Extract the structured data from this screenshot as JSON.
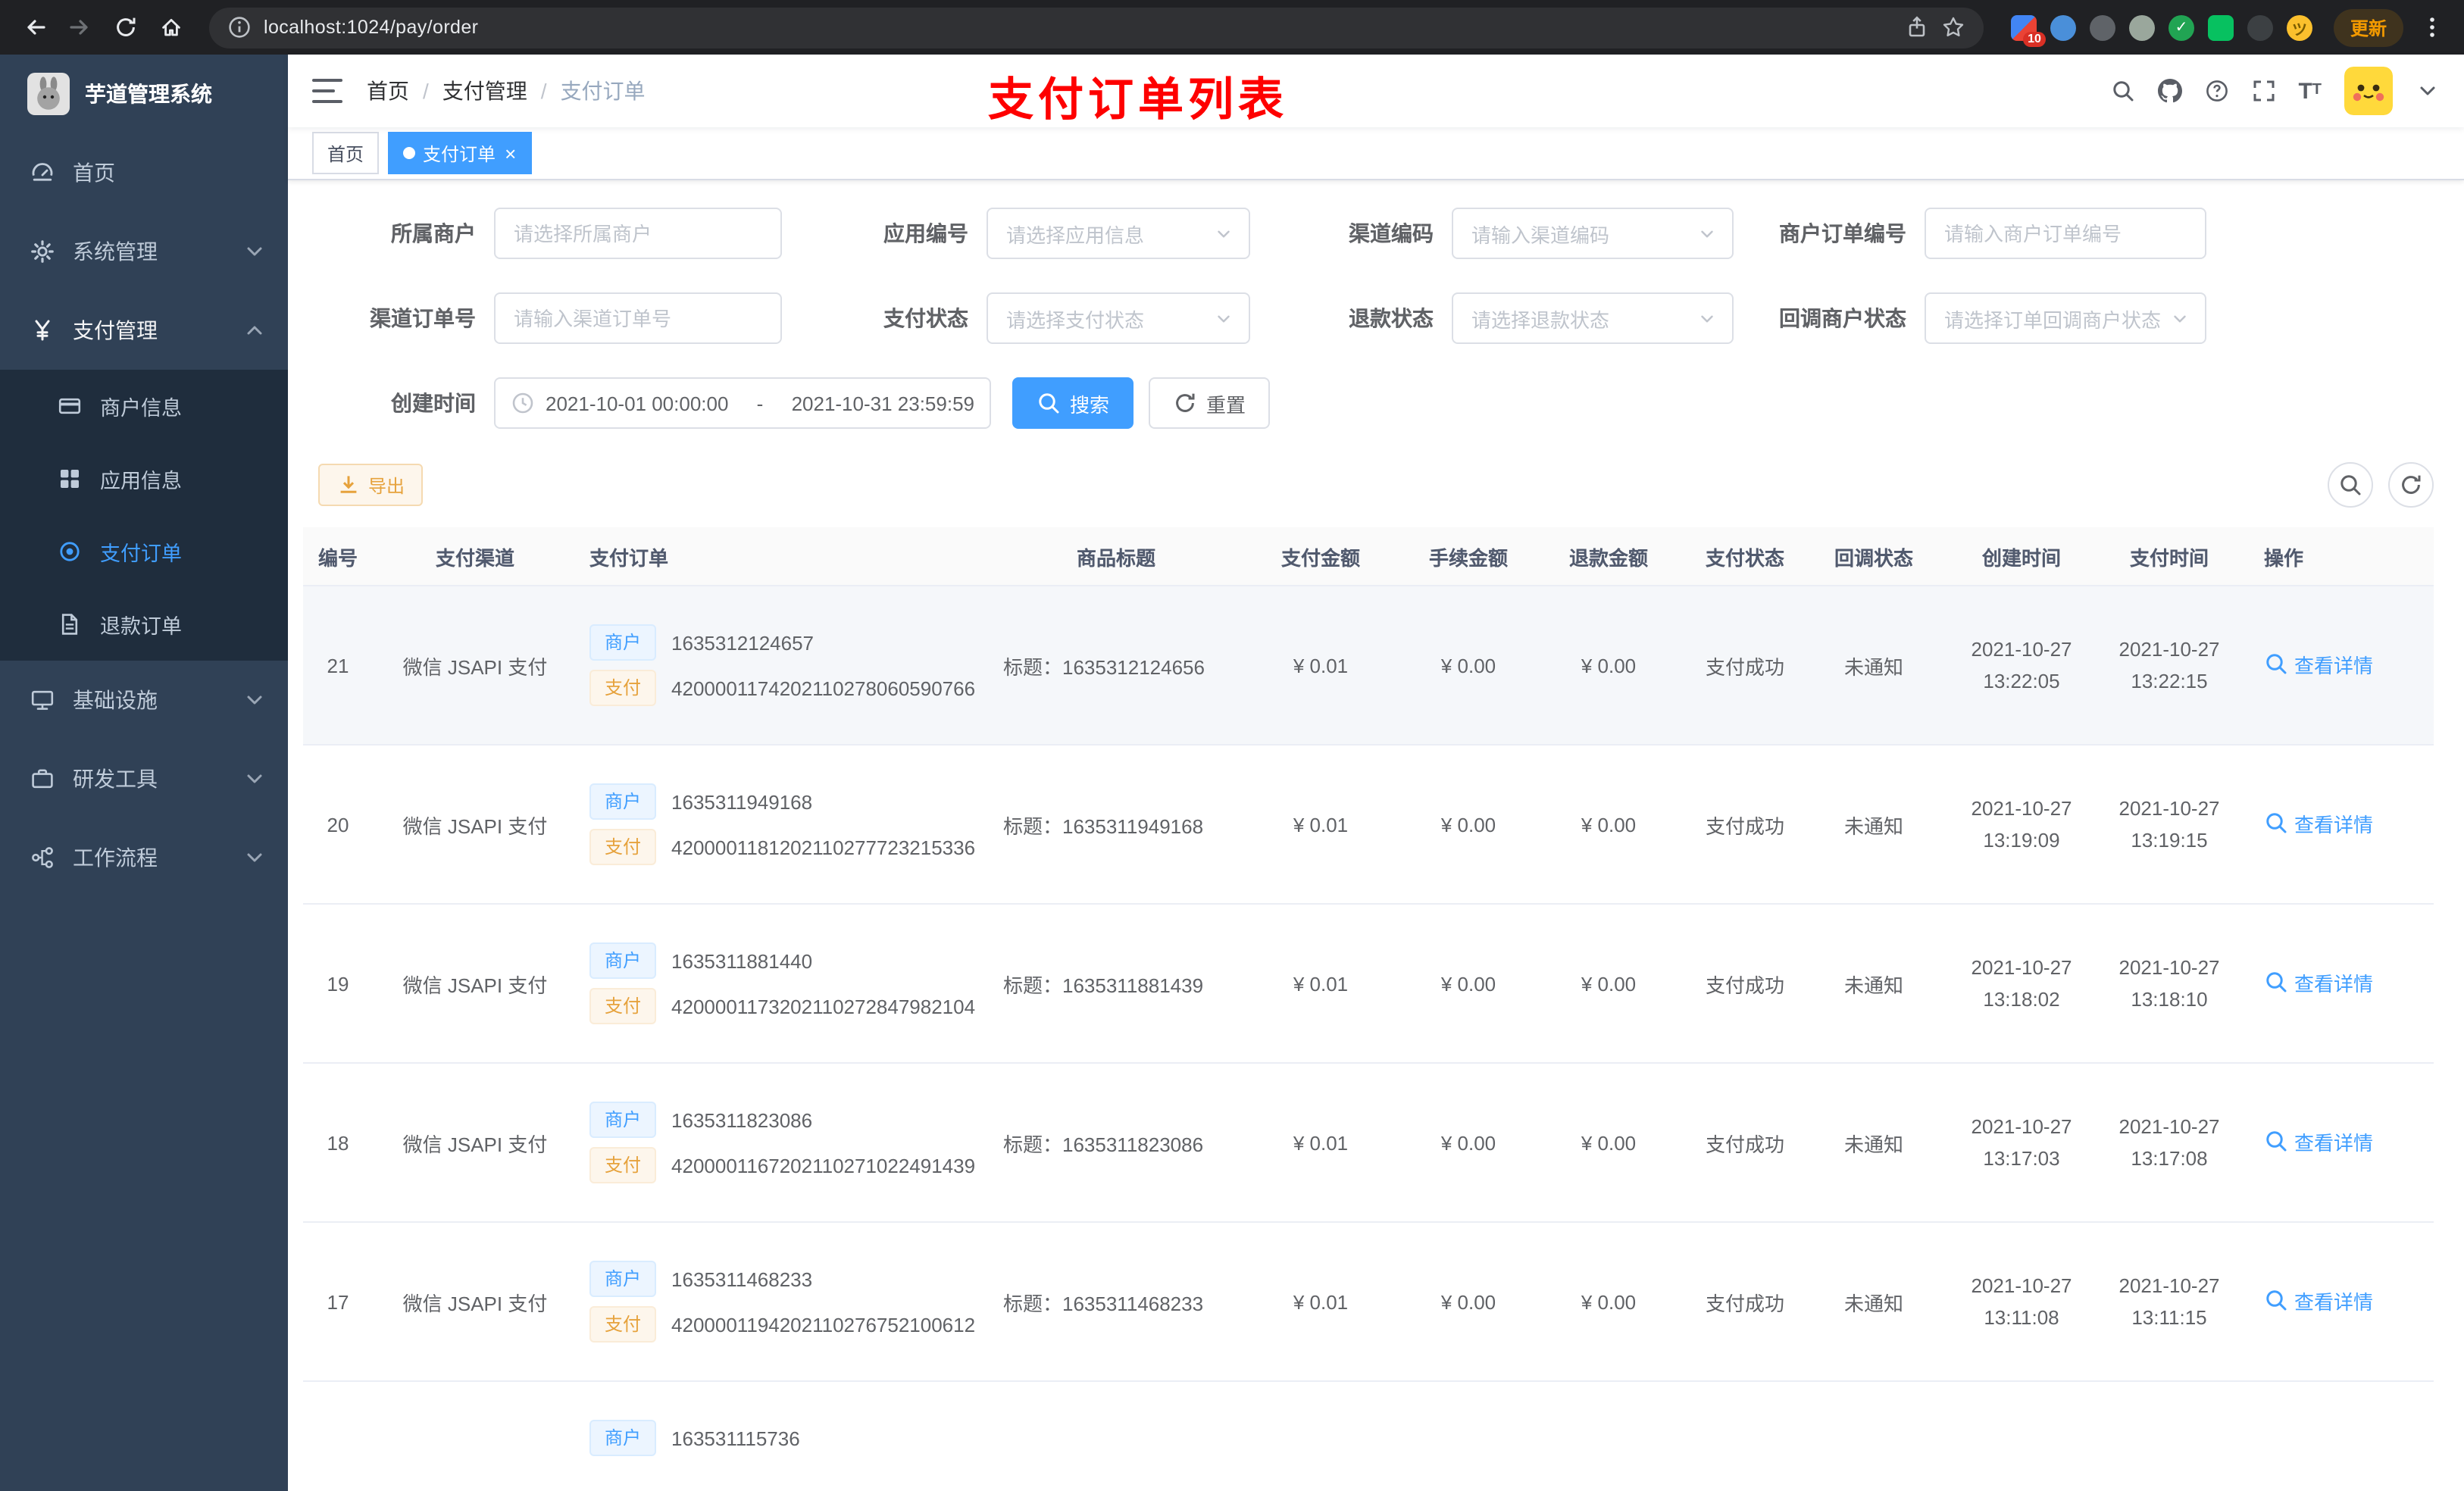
{
  "colors": {
    "accent": "#409EFF",
    "warning": "#E6A23C",
    "annotation": "#FE0000",
    "sidebar_bg": "#304156"
  },
  "browser": {
    "url": "localhost:1024/pay/order",
    "update_label": "更新",
    "extension_badge": "10"
  },
  "sidebar": {
    "app_title": "芋道管理系统",
    "items": [
      {
        "label": "首页"
      },
      {
        "label": "系统管理"
      },
      {
        "label": "支付管理"
      },
      {
        "label": "基础设施"
      },
      {
        "label": "研发工具"
      },
      {
        "label": "工作流程"
      }
    ],
    "pay_submenu": [
      {
        "label": "商户信息"
      },
      {
        "label": "应用信息"
      },
      {
        "label": "支付订单"
      },
      {
        "label": "退款订单"
      }
    ]
  },
  "header": {
    "breadcrumb": [
      {
        "label": "首页"
      },
      {
        "label": "支付管理"
      },
      {
        "label": "支付订单"
      }
    ],
    "separator": "/",
    "annotation": "支付订单列表"
  },
  "tabs": [
    {
      "label": "首页"
    },
    {
      "label": "支付订单",
      "close": "×"
    }
  ],
  "filters": {
    "merchant": {
      "label": "所属商户",
      "placeholder": "请选择所属商户"
    },
    "app": {
      "label": "应用编号",
      "placeholder": "请选择应用信息"
    },
    "channel_code": {
      "label": "渠道编码",
      "placeholder": "请输入渠道编码"
    },
    "merchant_order_no": {
      "label": "商户订单编号",
      "placeholder": "请输入商户订单编号"
    },
    "channel_order_no": {
      "label": "渠道订单号",
      "placeholder": "请输入渠道订单号"
    },
    "pay_status": {
      "label": "支付状态",
      "placeholder": "请选择支付状态"
    },
    "refund_status": {
      "label": "退款状态",
      "placeholder": "请选择退款状态"
    },
    "notify_status": {
      "label": "回调商户状态",
      "placeholder": "请选择订单回调商户状态"
    },
    "create_time": {
      "label": "创建时间",
      "start": "2021-10-01 00:00:00",
      "separator": "-",
      "end": "2021-10-31 23:59:59"
    },
    "search_label": "搜索",
    "reset_label": "重置"
  },
  "toolbar": {
    "export_label": "导出"
  },
  "table": {
    "headers": [
      "编号",
      "支付渠道",
      "支付订单",
      "商品标题",
      "支付金额",
      "手续金额",
      "退款金额",
      "支付状态",
      "回调状态",
      "创建时间",
      "支付时间",
      "操作"
    ],
    "tag_merchant": "商户",
    "tag_pay": "支付",
    "action_label": "查看详情",
    "rows": [
      {
        "id": "21",
        "channel": "微信 JSAPI 支付",
        "merchant_no": "1635312124657",
        "pay_no": "4200001174202110278060590766",
        "title": "标题：1635312124656",
        "amount": "¥ 0.01",
        "fee": "¥ 0.00",
        "refund": "¥ 0.00",
        "status": "支付成功",
        "notify": "未通知",
        "created_date": "2021-10-27",
        "created_time": "13:22:05",
        "paid_date": "2021-10-27",
        "paid_time": "13:22:15"
      },
      {
        "id": "20",
        "channel": "微信 JSAPI 支付",
        "merchant_no": "1635311949168",
        "pay_no": "4200001181202110277723215336",
        "title": "标题：1635311949168",
        "amount": "¥ 0.01",
        "fee": "¥ 0.00",
        "refund": "¥ 0.00",
        "status": "支付成功",
        "notify": "未通知",
        "created_date": "2021-10-27",
        "created_time": "13:19:09",
        "paid_date": "2021-10-27",
        "paid_time": "13:19:15"
      },
      {
        "id": "19",
        "channel": "微信 JSAPI 支付",
        "merchant_no": "1635311881440",
        "pay_no": "4200001173202110272847982104",
        "title": "标题：1635311881439",
        "amount": "¥ 0.01",
        "fee": "¥ 0.00",
        "refund": "¥ 0.00",
        "status": "支付成功",
        "notify": "未通知",
        "created_date": "2021-10-27",
        "created_time": "13:18:02",
        "paid_date": "2021-10-27",
        "paid_time": "13:18:10"
      },
      {
        "id": "18",
        "channel": "微信 JSAPI 支付",
        "merchant_no": "1635311823086",
        "pay_no": "4200001167202110271022491439",
        "title": "标题：1635311823086",
        "amount": "¥ 0.01",
        "fee": "¥ 0.00",
        "refund": "¥ 0.00",
        "status": "支付成功",
        "notify": "未通知",
        "created_date": "2021-10-27",
        "created_time": "13:17:03",
        "paid_date": "2021-10-27",
        "paid_time": "13:17:08"
      },
      {
        "id": "17",
        "channel": "微信 JSAPI 支付",
        "merchant_no": "1635311468233",
        "pay_no": "4200001194202110276752100612",
        "title": "标题：1635311468233",
        "amount": "¥ 0.01",
        "fee": "¥ 0.00",
        "refund": "¥ 0.00",
        "status": "支付成功",
        "notify": "未通知",
        "created_date": "2021-10-27",
        "created_time": "13:11:08",
        "paid_date": "2021-10-27",
        "paid_time": "13:11:15"
      },
      {
        "merchant_no": "163531115736"
      }
    ]
  }
}
